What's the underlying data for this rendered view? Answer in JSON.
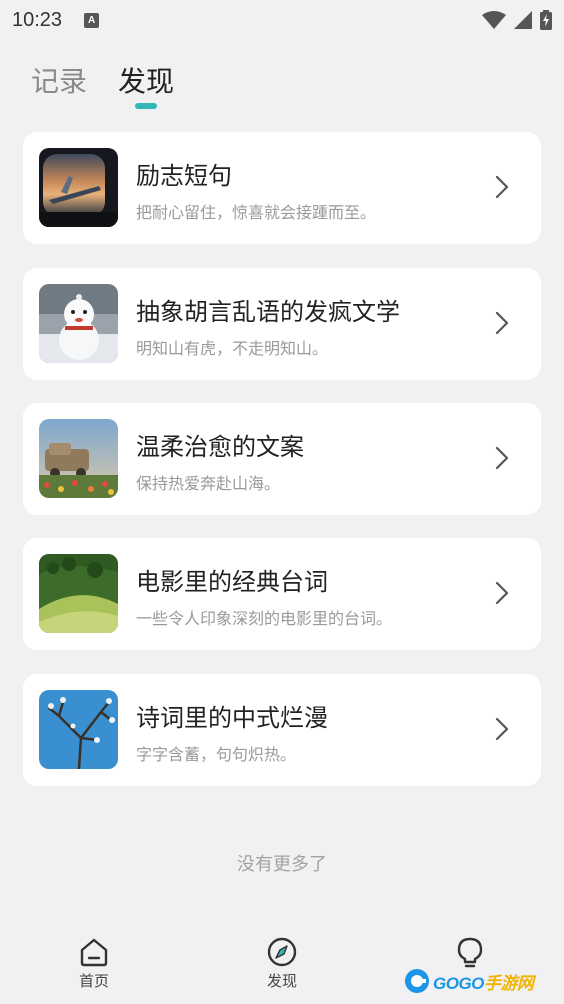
{
  "status_bar": {
    "time": "10:23",
    "notification_badge": "A"
  },
  "tabs": [
    {
      "label": "记录",
      "active": false
    },
    {
      "label": "发现",
      "active": true
    }
  ],
  "accent_color": "#33b7b6",
  "cards": [
    {
      "title": "励志短句",
      "subtitle": "把耐心留住，惊喜就会接踵而至。",
      "image": "airplane-window-sunset"
    },
    {
      "title": "抽象胡言乱语的发疯文学",
      "subtitle": "明知山有虎，不走明知山。",
      "image": "snowman"
    },
    {
      "title": "温柔治愈的文案",
      "subtitle": "保持热爱奔赴山海。",
      "image": "old-car-flowers"
    },
    {
      "title": "电影里的经典台词",
      "subtitle": "一些令人印象深刻的电影里的台词。",
      "image": "green-hillside"
    },
    {
      "title": "诗词里的中式烂漫",
      "subtitle": "字字含蓄，句句炽热。",
      "image": "tree-blue-sky"
    }
  ],
  "footer_text": "没有更多了",
  "bottom_nav": [
    {
      "label": "首页",
      "icon": "home-icon"
    },
    {
      "label": "发现",
      "icon": "compass-icon"
    },
    {
      "label": "",
      "icon": "lightbulb-icon"
    }
  ],
  "watermark": {
    "brand": "GOGO",
    "suffix": "手游网"
  }
}
